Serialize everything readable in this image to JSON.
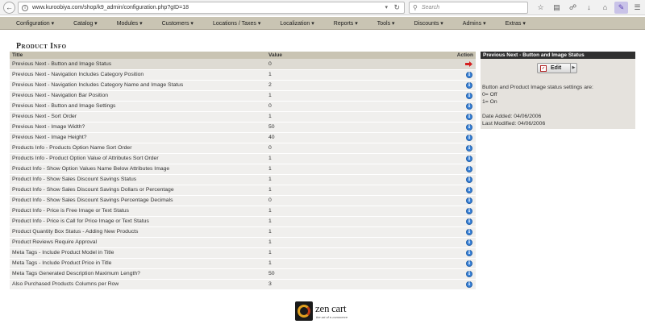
{
  "browser": {
    "url": "www.kuroobiya.com/shop/k9_admin/configuration.php?gID=18",
    "search_placeholder": "Search"
  },
  "nav": {
    "items": [
      {
        "label": "Configuration ▾"
      },
      {
        "label": "Catalog ▾"
      },
      {
        "label": "Modules ▾"
      },
      {
        "label": "Customers ▾"
      },
      {
        "label": "Locations / Taxes ▾"
      },
      {
        "label": "Localization ▾"
      },
      {
        "label": "Reports ▾"
      },
      {
        "label": "Tools ▾"
      },
      {
        "label": "Discounts ▾"
      },
      {
        "label": "Admins ▾"
      },
      {
        "label": "Extras ▾"
      }
    ]
  },
  "page": {
    "title": "Product Info"
  },
  "table": {
    "headers": {
      "title": "Title",
      "value": "Value",
      "action": "Action"
    },
    "rows": [
      {
        "title": "Previous Next - Button and Image Status",
        "value": "0"
      },
      {
        "title": "Previous Next - Navigation Includes Category Position",
        "value": "1"
      },
      {
        "title": "Previous Next - Navigation Includes Category Name and Image Status",
        "value": "2"
      },
      {
        "title": "Previous Next - Navigation Bar Position",
        "value": "1"
      },
      {
        "title": "Previous Next - Button and Image Settings",
        "value": "0"
      },
      {
        "title": "Previous Next - Sort Order",
        "value": "1"
      },
      {
        "title": "Previous Next - Image Width?",
        "value": "50"
      },
      {
        "title": "Previous Next - Image Height?",
        "value": "40"
      },
      {
        "title": "Products Info - Products Option Name Sort Order",
        "value": "0"
      },
      {
        "title": "Products Info - Product Option Value of Attributes Sort Order",
        "value": "1"
      },
      {
        "title": "Product Info - Show Option Values Name Below Attributes Image",
        "value": "1"
      },
      {
        "title": "Product Info - Show Sales Discount Savings Status",
        "value": "1"
      },
      {
        "title": "Product Info - Show Sales Discount Savings Dollars or Percentage",
        "value": "1"
      },
      {
        "title": "Product Info - Show Sales Discount Savings Percentage Decimals",
        "value": "0"
      },
      {
        "title": "Product Info - Price is Free Image or Text Status",
        "value": "1"
      },
      {
        "title": "Product Info - Price is Call for Price Image or Text Status",
        "value": "1"
      },
      {
        "title": "Product Quantity Box Status - Adding New Products",
        "value": "1"
      },
      {
        "title": "Product Reviews Require Approval",
        "value": "1"
      },
      {
        "title": "Meta Tags - Include Product Model in Title",
        "value": "1"
      },
      {
        "title": "Meta Tags - Include Product Price in Title",
        "value": "1"
      },
      {
        "title": "Meta Tags Generated Description Maximum Length?",
        "value": "50"
      },
      {
        "title": "Also Purchased Products Columns per Row",
        "value": "3"
      }
    ]
  },
  "side_panel": {
    "header": "Previous Next - Button and Image Status",
    "edit_label": "Edit",
    "description": "Button and Product Image status settings are:",
    "option_off": "0= Off",
    "option_on": "1= On",
    "date_added": "Date Added: 04/06/2006",
    "last_modified": "Last Modified: 04/06/2006"
  },
  "footer": {
    "logo_text": "zen cart",
    "logo_tagline": "the art of e-commerce"
  },
  "colors": {
    "nav_bg": "#c9c4b3",
    "row_bg": "#f0efed",
    "selected_row_bg": "#dedbd3",
    "panel_header_bg": "#303030",
    "info_icon": "#3b83d9",
    "arrow_icon": "#d42020"
  }
}
